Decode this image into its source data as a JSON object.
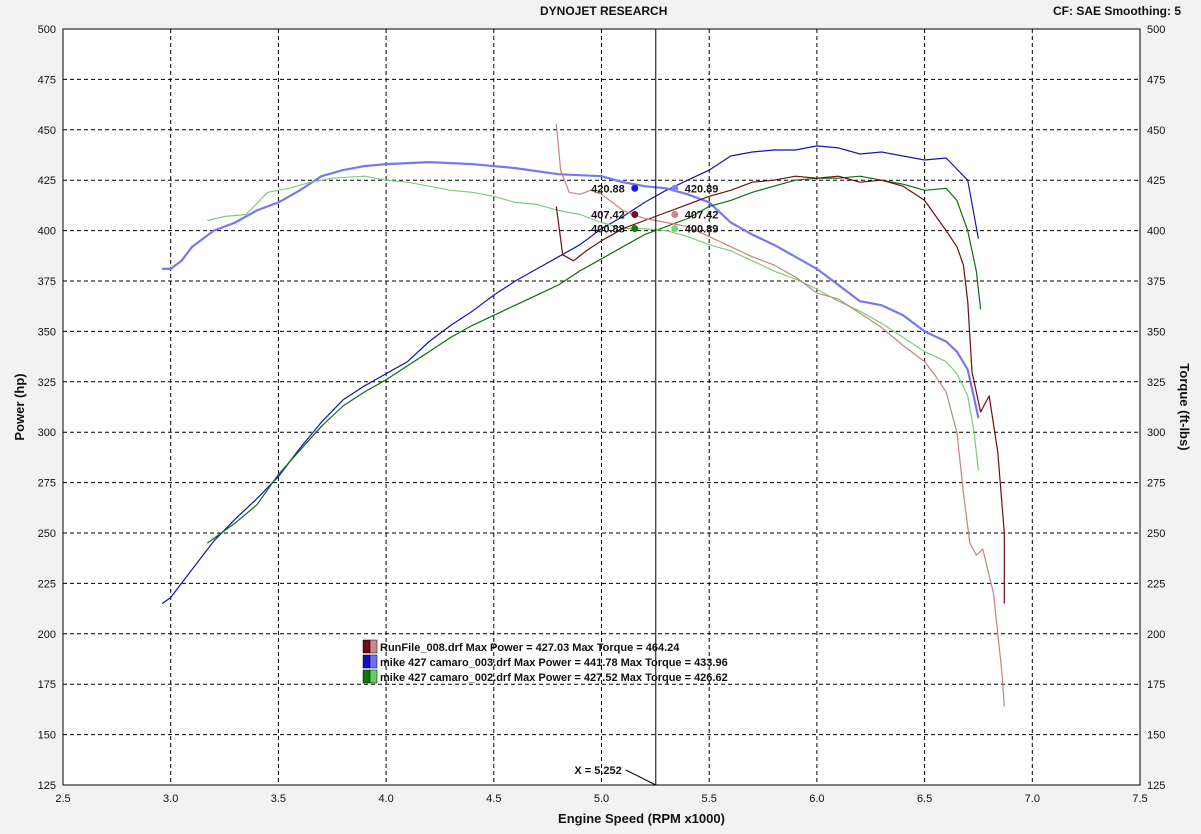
{
  "header": {
    "title": "DYNOJET RESEARCH",
    "settings": "CF: SAE  Smoothing: 5"
  },
  "chart_data": {
    "type": "line",
    "xlabel": "Engine Speed (RPM x1000)",
    "ylabel": "Power (hp)",
    "y2label": "Torque (ft-lbs)",
    "xlim": [
      2.5,
      7.5
    ],
    "ylim": [
      125,
      500
    ],
    "y2lim": [
      125,
      500
    ],
    "x_ticks": [
      "2.5",
      "3.0",
      "3.5",
      "4.0",
      "4.5",
      "5.0",
      "5.5",
      "6.0",
      "6.5",
      "7.0",
      "7.5"
    ],
    "y_ticks": [
      "125",
      "150",
      "175",
      "200",
      "225",
      "250",
      "275",
      "300",
      "325",
      "350",
      "375",
      "400",
      "425",
      "450",
      "475",
      "500"
    ],
    "grid": true,
    "cursor": {
      "x": 5.252,
      "label": "X = 5.252"
    },
    "cursor_points": [
      {
        "label": "420.88",
        "y": 421,
        "color": "#1a1ae6",
        "side": "left"
      },
      {
        "label": "420.89",
        "y": 421,
        "color": "#8080ff",
        "side": "right"
      },
      {
        "label": "407.42",
        "y": 408,
        "color": "#7a1010",
        "side": "left"
      },
      {
        "label": "407.42",
        "y": 408,
        "color": "#c88a8a",
        "side": "right"
      },
      {
        "label": "400.88",
        "y": 401,
        "color": "#108010",
        "side": "left"
      },
      {
        "label": "400.89",
        "y": 401,
        "color": "#80d080",
        "side": "right"
      }
    ],
    "legend": [
      {
        "text": "RunFile_008.drf Max Power = 427.03 Max Torque = 464.24",
        "dark": "#6e0e0e",
        "light": "#c88a8a"
      },
      {
        "text": "mike 427 camaro_003.drf Max Power = 441.78 Max Torque = 433.96",
        "dark": "#1010c0",
        "light": "#7070ff"
      },
      {
        "text": "mike 427 camaro_002.drf Max Power = 427.52 Max Torque = 426.62",
        "dark": "#0a7a0a",
        "light": "#66cc66"
      }
    ],
    "series": [
      {
        "color": "#1515b0",
        "width": 1.2,
        "points": [
          [
            2.96,
            215
          ],
          [
            3.0,
            218
          ],
          [
            3.1,
            232
          ],
          [
            3.2,
            246
          ],
          [
            3.3,
            257
          ],
          [
            3.4,
            267
          ],
          [
            3.5,
            278
          ],
          [
            3.6,
            292
          ],
          [
            3.7,
            305
          ],
          [
            3.8,
            316
          ],
          [
            3.9,
            323
          ],
          [
            4.0,
            329
          ],
          [
            4.1,
            335
          ],
          [
            4.2,
            345
          ],
          [
            4.3,
            353
          ],
          [
            4.4,
            360
          ],
          [
            4.5,
            368
          ],
          [
            4.6,
            375
          ],
          [
            4.7,
            381
          ],
          [
            4.8,
            387
          ],
          [
            4.9,
            393
          ],
          [
            5.0,
            401
          ],
          [
            5.1,
            407
          ],
          [
            5.2,
            414
          ],
          [
            5.3,
            420
          ],
          [
            5.4,
            425
          ],
          [
            5.5,
            430
          ],
          [
            5.6,
            437
          ],
          [
            5.7,
            439
          ],
          [
            5.8,
            440
          ],
          [
            5.9,
            440
          ],
          [
            6.0,
            442
          ],
          [
            6.1,
            441
          ],
          [
            6.2,
            438
          ],
          [
            6.3,
            439
          ],
          [
            6.4,
            437
          ],
          [
            6.5,
            435
          ],
          [
            6.6,
            436
          ],
          [
            6.7,
            425
          ],
          [
            6.75,
            396
          ]
        ]
      },
      {
        "color": "#7878ee",
        "width": 2.2,
        "points": [
          [
            2.96,
            381
          ],
          [
            3.0,
            381
          ],
          [
            3.05,
            385
          ],
          [
            3.1,
            392
          ],
          [
            3.2,
            400
          ],
          [
            3.3,
            404
          ],
          [
            3.4,
            410
          ],
          [
            3.5,
            414
          ],
          [
            3.6,
            420
          ],
          [
            3.7,
            427
          ],
          [
            3.8,
            430
          ],
          [
            3.9,
            432
          ],
          [
            4.0,
            433
          ],
          [
            4.2,
            434
          ],
          [
            4.4,
            433
          ],
          [
            4.6,
            431
          ],
          [
            4.8,
            428
          ],
          [
            5.0,
            427
          ],
          [
            5.1,
            424
          ],
          [
            5.2,
            422
          ],
          [
            5.3,
            421
          ],
          [
            5.4,
            418
          ],
          [
            5.5,
            414
          ],
          [
            5.6,
            404
          ],
          [
            5.7,
            398
          ],
          [
            5.8,
            393
          ],
          [
            5.9,
            387
          ],
          [
            6.0,
            381
          ],
          [
            6.1,
            373
          ],
          [
            6.2,
            365
          ],
          [
            6.3,
            363
          ],
          [
            6.4,
            358
          ],
          [
            6.5,
            350
          ],
          [
            6.6,
            345
          ],
          [
            6.65,
            340
          ],
          [
            6.7,
            331
          ],
          [
            6.73,
            317
          ],
          [
            6.75,
            307
          ]
        ]
      },
      {
        "color": "#0d6e0d",
        "width": 1.2,
        "points": [
          [
            3.17,
            245
          ],
          [
            3.3,
            255
          ],
          [
            3.4,
            264
          ],
          [
            3.5,
            279
          ],
          [
            3.6,
            291
          ],
          [
            3.7,
            303
          ],
          [
            3.8,
            313
          ],
          [
            3.9,
            320
          ],
          [
            4.0,
            326
          ],
          [
            4.1,
            333
          ],
          [
            4.2,
            340
          ],
          [
            4.3,
            347
          ],
          [
            4.4,
            353
          ],
          [
            4.5,
            358
          ],
          [
            4.6,
            363
          ],
          [
            4.7,
            368
          ],
          [
            4.8,
            373
          ],
          [
            4.9,
            380
          ],
          [
            5.0,
            386
          ],
          [
            5.1,
            392
          ],
          [
            5.2,
            398
          ],
          [
            5.3,
            402
          ],
          [
            5.4,
            406
          ],
          [
            5.5,
            412
          ],
          [
            5.6,
            415
          ],
          [
            5.7,
            419
          ],
          [
            5.8,
            422
          ],
          [
            5.9,
            425
          ],
          [
            6.0,
            426
          ],
          [
            6.1,
            426
          ],
          [
            6.2,
            427
          ],
          [
            6.3,
            425
          ],
          [
            6.4,
            423
          ],
          [
            6.5,
            420
          ],
          [
            6.6,
            421
          ],
          [
            6.65,
            415
          ],
          [
            6.7,
            400
          ],
          [
            6.74,
            380
          ],
          [
            6.76,
            361
          ]
        ]
      },
      {
        "color": "#7ccc7c",
        "width": 1.2,
        "points": [
          [
            3.17,
            405
          ],
          [
            3.25,
            407
          ],
          [
            3.35,
            408
          ],
          [
            3.45,
            419
          ],
          [
            3.55,
            421
          ],
          [
            3.65,
            424
          ],
          [
            3.75,
            426
          ],
          [
            3.9,
            427
          ],
          [
            4.0,
            425
          ],
          [
            4.1,
            424
          ],
          [
            4.2,
            422
          ],
          [
            4.3,
            420
          ],
          [
            4.4,
            419
          ],
          [
            4.5,
            417
          ],
          [
            4.6,
            414
          ],
          [
            4.7,
            413
          ],
          [
            4.8,
            410
          ],
          [
            4.9,
            408
          ],
          [
            5.0,
            404
          ],
          [
            5.1,
            401
          ],
          [
            5.2,
            401
          ],
          [
            5.3,
            400
          ],
          [
            5.4,
            397
          ],
          [
            5.5,
            393
          ],
          [
            5.6,
            390
          ],
          [
            5.7,
            385
          ],
          [
            5.8,
            380
          ],
          [
            5.9,
            376
          ],
          [
            6.0,
            371
          ],
          [
            6.1,
            365
          ],
          [
            6.2,
            360
          ],
          [
            6.3,
            354
          ],
          [
            6.4,
            347
          ],
          [
            6.5,
            340
          ],
          [
            6.6,
            335
          ],
          [
            6.65,
            329
          ],
          [
            6.7,
            318
          ],
          [
            6.73,
            300
          ],
          [
            6.75,
            281
          ]
        ]
      },
      {
        "color": "#6e0e0e",
        "width": 1.2,
        "points": [
          [
            4.79,
            412
          ],
          [
            4.82,
            388
          ],
          [
            4.87,
            385
          ],
          [
            4.93,
            390
          ],
          [
            5.0,
            395
          ],
          [
            5.1,
            401
          ],
          [
            5.2,
            405
          ],
          [
            5.3,
            409
          ],
          [
            5.4,
            413
          ],
          [
            5.5,
            417
          ],
          [
            5.6,
            420
          ],
          [
            5.7,
            424
          ],
          [
            5.8,
            425
          ],
          [
            5.9,
            427
          ],
          [
            6.0,
            426
          ],
          [
            6.1,
            427
          ],
          [
            6.2,
            424
          ],
          [
            6.3,
            425
          ],
          [
            6.4,
            422
          ],
          [
            6.5,
            415
          ],
          [
            6.6,
            400
          ],
          [
            6.65,
            392
          ],
          [
            6.68,
            383
          ],
          [
            6.7,
            365
          ],
          [
            6.72,
            330
          ],
          [
            6.76,
            310
          ],
          [
            6.8,
            318
          ],
          [
            6.84,
            290
          ],
          [
            6.87,
            250
          ],
          [
            6.87,
            215
          ]
        ]
      },
      {
        "color": "#c4857f",
        "width": 1.2,
        "points": [
          [
            4.79,
            453
          ],
          [
            4.81,
            430
          ],
          [
            4.85,
            419
          ],
          [
            4.9,
            418
          ],
          [
            4.95,
            420
          ],
          [
            5.0,
            418
          ],
          [
            5.05,
            414
          ],
          [
            5.1,
            410
          ],
          [
            5.2,
            406
          ],
          [
            5.3,
            404
          ],
          [
            5.4,
            402
          ],
          [
            5.5,
            397
          ],
          [
            5.6,
            392
          ],
          [
            5.7,
            387
          ],
          [
            5.8,
            383
          ],
          [
            5.9,
            377
          ],
          [
            6.0,
            369
          ],
          [
            6.1,
            366
          ],
          [
            6.2,
            359
          ],
          [
            6.3,
            352
          ],
          [
            6.4,
            343
          ],
          [
            6.5,
            335
          ],
          [
            6.55,
            328
          ],
          [
            6.6,
            320
          ],
          [
            6.65,
            300
          ],
          [
            6.68,
            270
          ],
          [
            6.71,
            245
          ],
          [
            6.74,
            239
          ],
          [
            6.77,
            242
          ],
          [
            6.82,
            220
          ],
          [
            6.86,
            180
          ],
          [
            6.87,
            164
          ]
        ]
      }
    ]
  }
}
